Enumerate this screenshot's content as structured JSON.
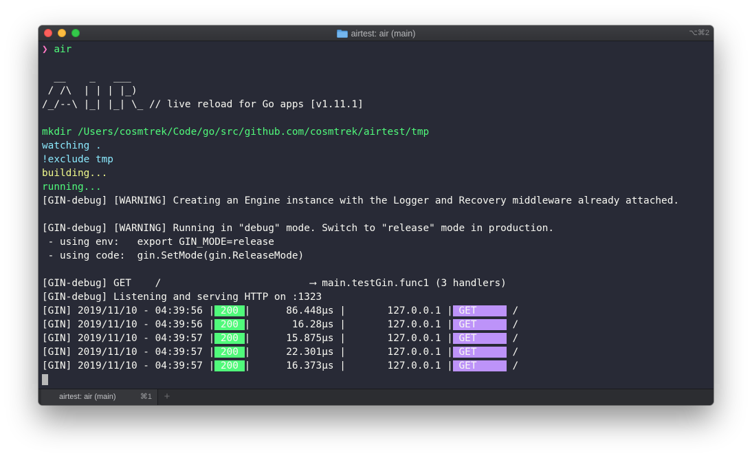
{
  "window": {
    "title": "airtest: air (main)",
    "title_shortcut": "⌥⌘2"
  },
  "terminal": {
    "lines": [
      [
        {
          "t": "❯ ",
          "c": "pink"
        },
        {
          "t": "air",
          "c": "green"
        }
      ],
      [],
      [
        {
          "t": "  __    _   ___  "
        }
      ],
      [
        {
          "t": " / /\\  | | | |_) "
        }
      ],
      [
        {
          "t": "/_/--\\ |_| |_| \\_ // live reload for Go apps [v1.11.1]"
        }
      ],
      [],
      [
        {
          "t": "mkdir /Users/cosmtrek/Code/go/src/github.com/cosmtrek/airtest/tmp",
          "c": "green"
        }
      ],
      [
        {
          "t": "watching .",
          "c": "cyan"
        }
      ],
      [
        {
          "t": "!exclude tmp",
          "c": "cyan"
        }
      ],
      [
        {
          "t": "building...",
          "c": "yellow"
        }
      ],
      [
        {
          "t": "running...",
          "c": "green"
        }
      ],
      [
        {
          "t": "[GIN-debug] [WARNING] Creating an Engine instance with the Logger and Recovery middleware already attached."
        }
      ],
      [],
      [
        {
          "t": "[GIN-debug] [WARNING] Running in \"debug\" mode. Switch to \"release\" mode in production."
        }
      ],
      [
        {
          "t": " - using env:   export GIN_MODE=release"
        }
      ],
      [
        {
          "t": " - using code:  gin.SetMode(gin.ReleaseMode)"
        }
      ],
      [],
      [
        {
          "t": "[GIN-debug] GET    /                         ⟶ main.testGin.func1 (3 handlers)"
        }
      ],
      [
        {
          "t": "[GIN-debug] Listening and serving HTTP on :1323"
        }
      ],
      [
        {
          "t": "[GIN] 2019/11/10 - 04:39:56 |"
        },
        {
          "t": " 200 ",
          "c": "badge-green"
        },
        {
          "t": "|      86.448µs |       127.0.0.1 |"
        },
        {
          "t": " GET     ",
          "c": "badge-purple"
        },
        {
          "t": " /"
        }
      ],
      [
        {
          "t": "[GIN] 2019/11/10 - 04:39:56 |"
        },
        {
          "t": " 200 ",
          "c": "badge-green"
        },
        {
          "t": "|       16.28µs |       127.0.0.1 |"
        },
        {
          "t": " GET     ",
          "c": "badge-purple"
        },
        {
          "t": " /"
        }
      ],
      [
        {
          "t": "[GIN] 2019/11/10 - 04:39:57 |"
        },
        {
          "t": " 200 ",
          "c": "badge-green"
        },
        {
          "t": "|      15.875µs |       127.0.0.1 |"
        },
        {
          "t": " GET     ",
          "c": "badge-purple"
        },
        {
          "t": " /"
        }
      ],
      [
        {
          "t": "[GIN] 2019/11/10 - 04:39:57 |"
        },
        {
          "t": " 200 ",
          "c": "badge-green"
        },
        {
          "t": "|      22.301µs |       127.0.0.1 |"
        },
        {
          "t": " GET     ",
          "c": "badge-purple"
        },
        {
          "t": " /"
        }
      ],
      [
        {
          "t": "[GIN] 2019/11/10 - 04:39:57 |"
        },
        {
          "t": " 200 ",
          "c": "badge-green"
        },
        {
          "t": "|      16.373µs |       127.0.0.1 |"
        },
        {
          "t": " GET     ",
          "c": "badge-purple"
        },
        {
          "t": " /"
        }
      ]
    ]
  },
  "tabbar": {
    "tab_title": "airtest: air (main)",
    "tab_shortcut": "⌘1",
    "add_label": "+"
  },
  "colors": {
    "background": "#282a36",
    "foreground": "#f8f8f2",
    "pink": "#ff79c6",
    "green": "#50fa7b",
    "cyan": "#8be9fd",
    "yellow": "#f1fa8c",
    "purple": "#bd93f9"
  },
  "icons": {
    "title_folder": "folder-icon",
    "cursor": "block-cursor"
  }
}
